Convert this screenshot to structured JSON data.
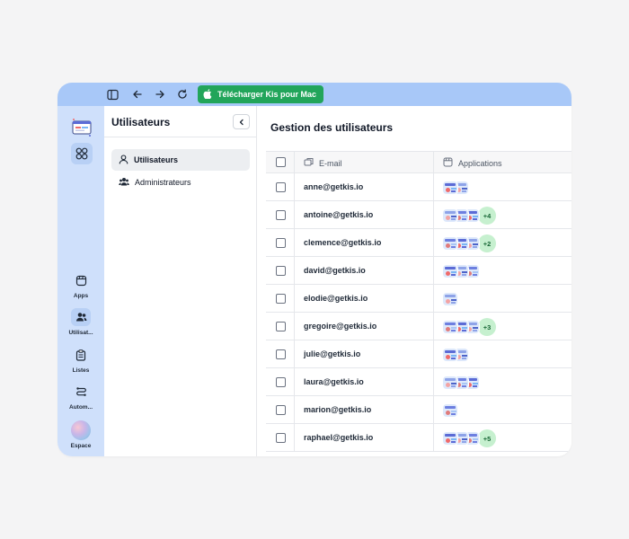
{
  "toolbar": {
    "download_label": "Télécharger Kis pour Mac",
    "icons": [
      "sidebar-toggle-icon",
      "arrow-left-icon",
      "arrow-right-icon",
      "refresh-icon",
      "apple-icon"
    ]
  },
  "rail": {
    "items": [
      {
        "label": "Apps",
        "icon": "apps-icon"
      },
      {
        "label": "Utilisat...",
        "icon": "users-icon"
      },
      {
        "label": "Listes",
        "icon": "clipboard-icon"
      },
      {
        "label": "Autom...",
        "icon": "automation-icon"
      },
      {
        "label": "Espace",
        "icon": "workspace-avatar-icon"
      }
    ]
  },
  "panel": {
    "title": "Utilisateurs",
    "nav": [
      {
        "label": "Utilisateurs",
        "icon": "user-icon",
        "active": true
      },
      {
        "label": "Administrateurs",
        "icon": "admins-icon",
        "active": false
      }
    ]
  },
  "main": {
    "title": "Gestion des utilisateurs",
    "columns": {
      "email": "E-mail",
      "apps": "Applications"
    },
    "rows": [
      {
        "email": "anne@getkis.io",
        "apps": 2,
        "more": ""
      },
      {
        "email": "antoine@getkis.io",
        "apps": 3,
        "more": "+4"
      },
      {
        "email": "clemence@getkis.io",
        "apps": 3,
        "more": "+2"
      },
      {
        "email": "david@getkis.io",
        "apps": 3,
        "more": ""
      },
      {
        "email": "elodie@getkis.io",
        "apps": 1,
        "more": ""
      },
      {
        "email": "gregoire@getkis.io",
        "apps": 3,
        "more": "+3"
      },
      {
        "email": "julie@getkis.io",
        "apps": 2,
        "more": ""
      },
      {
        "email": "laura@getkis.io",
        "apps": 3,
        "more": ""
      },
      {
        "email": "marion@getkis.io",
        "apps": 1,
        "more": ""
      },
      {
        "email": "raphael@getkis.io",
        "apps": 3,
        "more": "+5"
      }
    ]
  },
  "colors": {
    "topbar": "#a8c8f8",
    "rail": "#cfe0fb",
    "download_button": "#22a55a",
    "badge_bg": "#c6f0cf",
    "badge_text": "#166534"
  }
}
